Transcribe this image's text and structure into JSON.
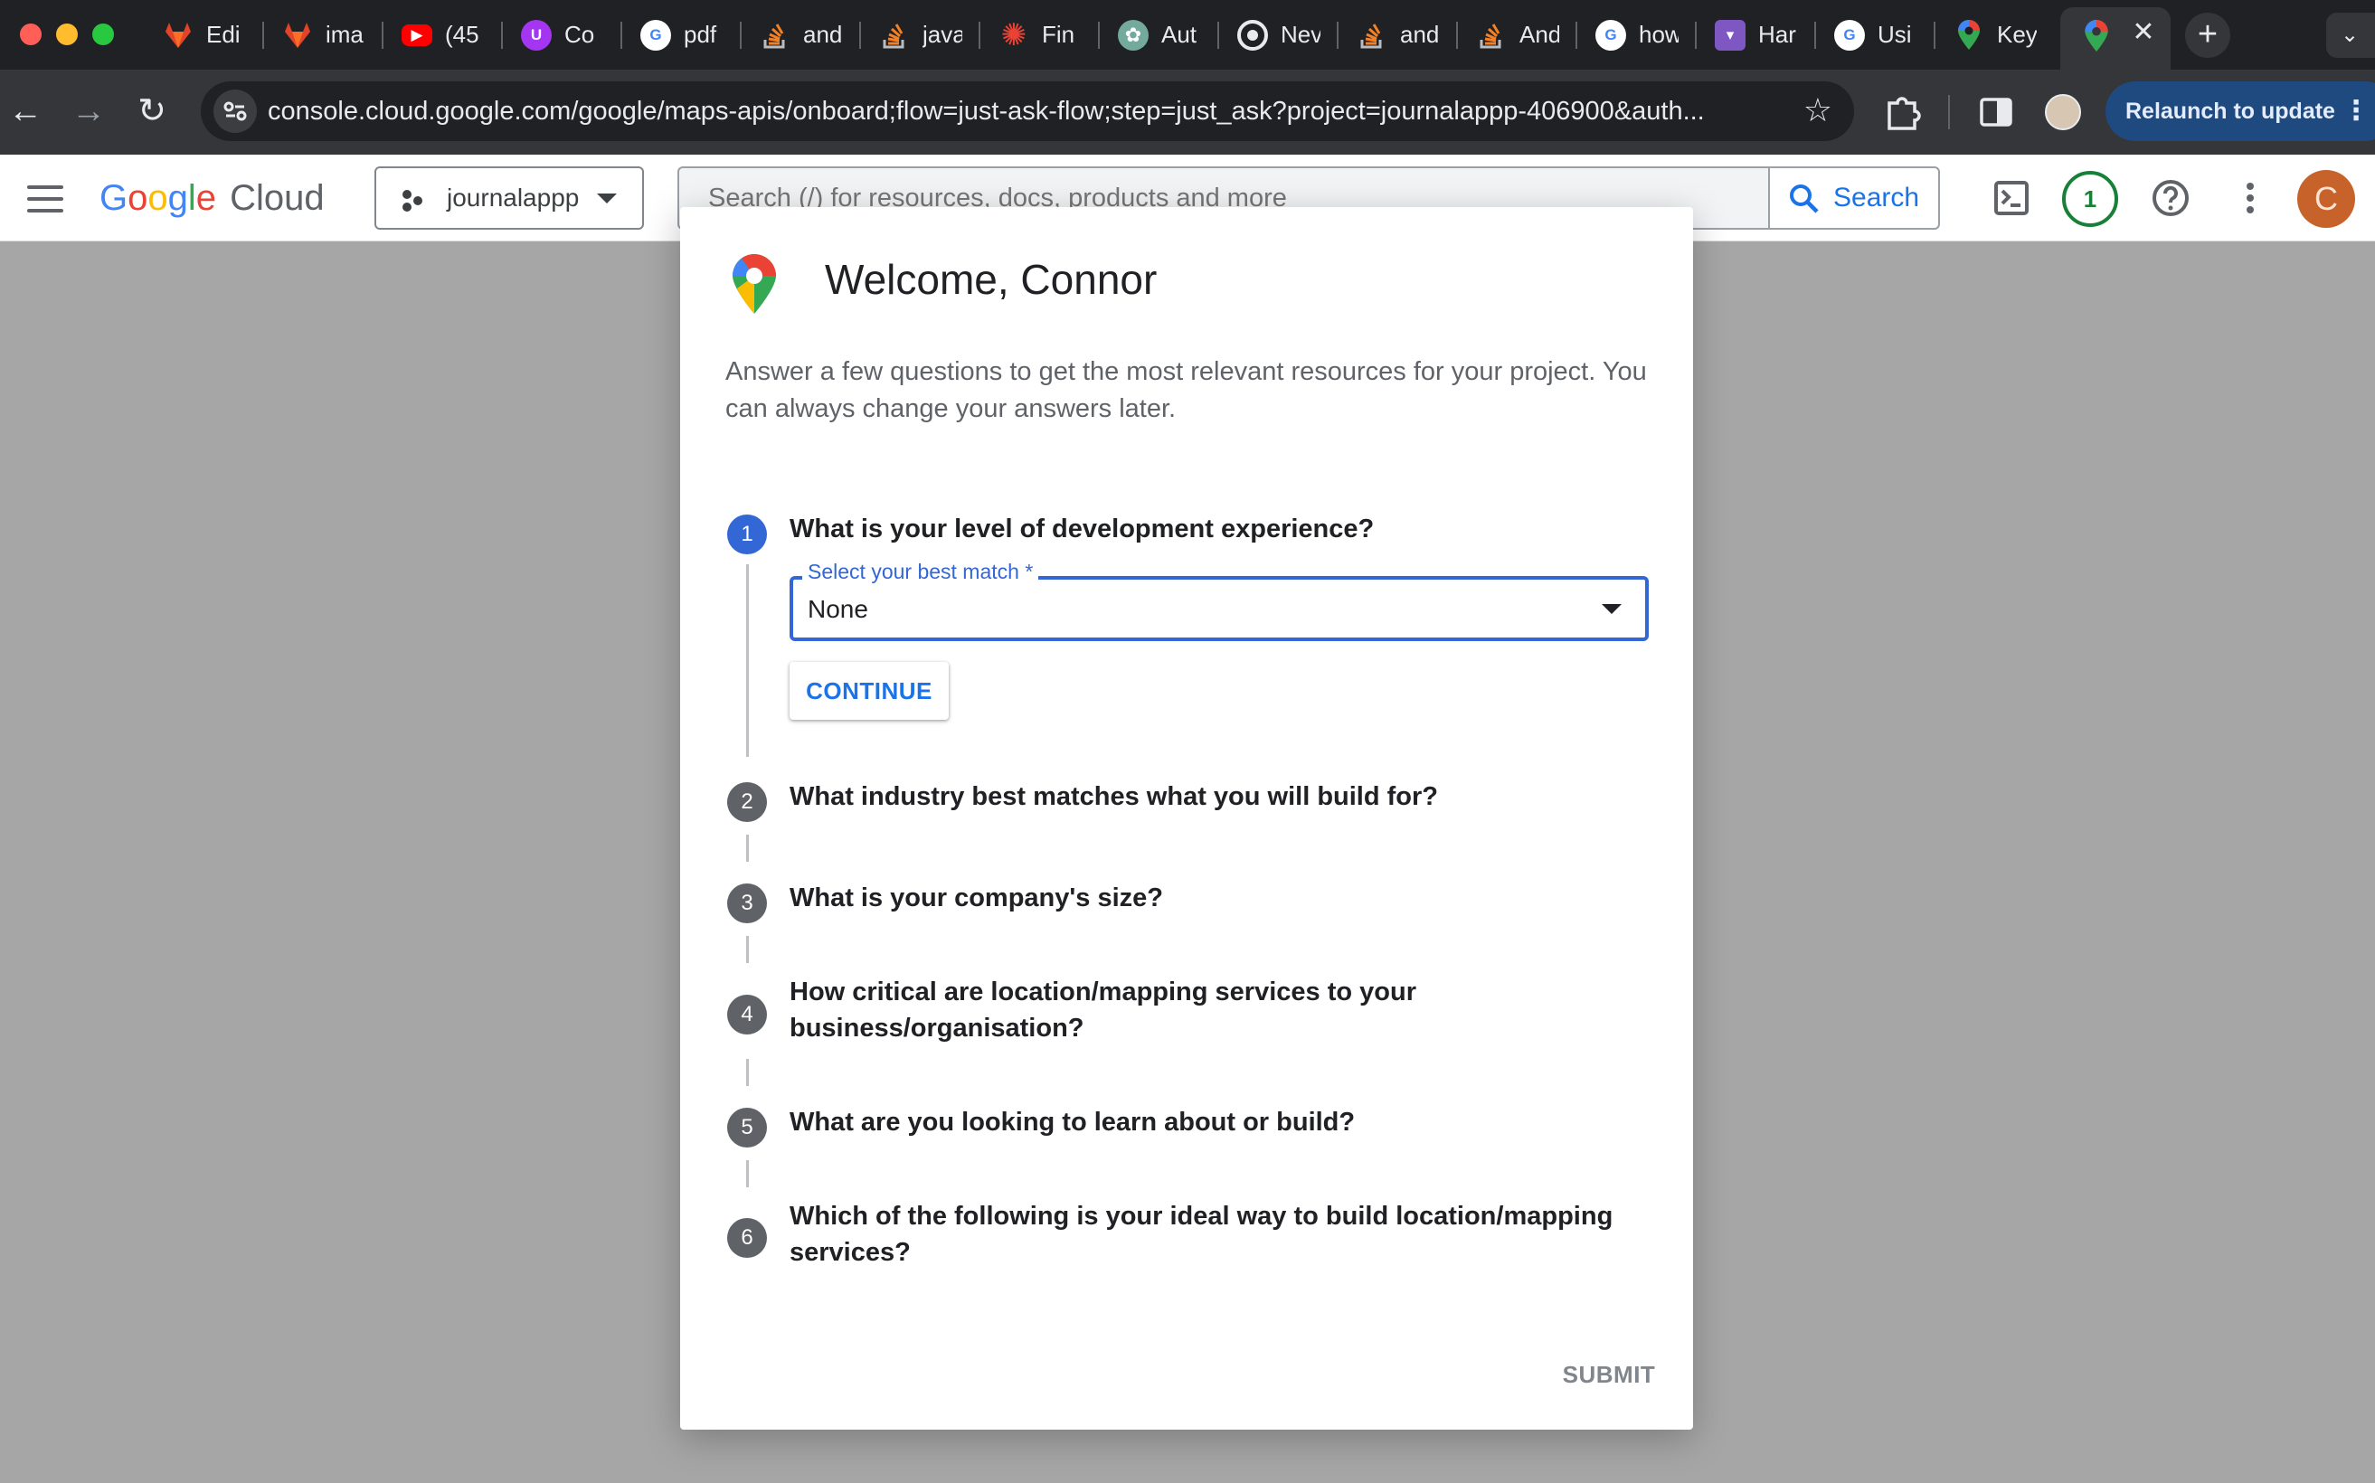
{
  "browser": {
    "tabs": [
      {
        "title": "Edi",
        "icon": "gitlab-icon",
        "color": "#e24329"
      },
      {
        "title": "ima",
        "icon": "gitlab-icon",
        "color": "#e24329"
      },
      {
        "title": "(45",
        "icon": "youtube-icon",
        "color": "#ff0000"
      },
      {
        "title": "Co",
        "icon": "udemy-icon",
        "color": "#a435f0"
      },
      {
        "title": "pdf",
        "icon": "google-icon",
        "color": "#ffffff"
      },
      {
        "title": "and",
        "icon": "stackoverflow-icon",
        "color": "#f48024"
      },
      {
        "title": "java",
        "icon": "stackoverflow-icon",
        "color": "#f48024"
      },
      {
        "title": "Fin",
        "icon": "asterisk-icon",
        "color": "#ea4335"
      },
      {
        "title": "Aut",
        "icon": "chatgpt-icon",
        "color": "#74aa9c"
      },
      {
        "title": "Nev",
        "icon": "chrome-icon",
        "color": "#e8eaed"
      },
      {
        "title": "and",
        "icon": "stackoverflow-icon",
        "color": "#f48024"
      },
      {
        "title": "And",
        "icon": "stackoverflow-icon",
        "color": "#f48024"
      },
      {
        "title": "how",
        "icon": "google-icon",
        "color": "#ffffff"
      },
      {
        "title": "Har",
        "icon": "bookmark-icon",
        "color": "#7e57c2"
      },
      {
        "title": "Usi",
        "icon": "google-icon",
        "color": "#ffffff"
      },
      {
        "title": "Key",
        "icon": "maps-icon",
        "color": "#34a853"
      }
    ],
    "url": "console.cloud.google.com/google/maps-apis/onboard;flow=just-ask-flow;step=just_ask?project=journalappp-406900&auth...",
    "relaunch_label": "Relaunch to update"
  },
  "console": {
    "logo_google": "Google",
    "logo_cloud": "Cloud",
    "project_name": "journalappp",
    "search_placeholder": "Search (/) for resources, docs, products and more",
    "search_button": "Search",
    "notification_count": "1",
    "avatar_initial": "C"
  },
  "dialog": {
    "title": "Welcome, Connor",
    "intro": "Answer a few questions to get the most relevant resources for your project. You can always change your answers later.",
    "steps": [
      {
        "number": "1",
        "question": "What is your level of development experience?"
      },
      {
        "number": "2",
        "question": "What industry best matches what you will build for?"
      },
      {
        "number": "3",
        "question": "What is your company's size?"
      },
      {
        "number": "4",
        "question": "How critical are location/mapping services to your business/organisation?"
      },
      {
        "number": "5",
        "question": "What are you looking to learn about or build?"
      },
      {
        "number": "6",
        "question": "Which of the following is your ideal way to build location/mapping services?"
      }
    ],
    "select_label": "Select your best match *",
    "select_value": "None",
    "continue_label": "CONTINUE",
    "submit_label": "SUBMIT"
  },
  "colors": {
    "primary_blue": "#3367d6",
    "link_blue": "#1a73e8",
    "step_gray": "#5f6368",
    "backdrop": "#a6a6a6"
  }
}
